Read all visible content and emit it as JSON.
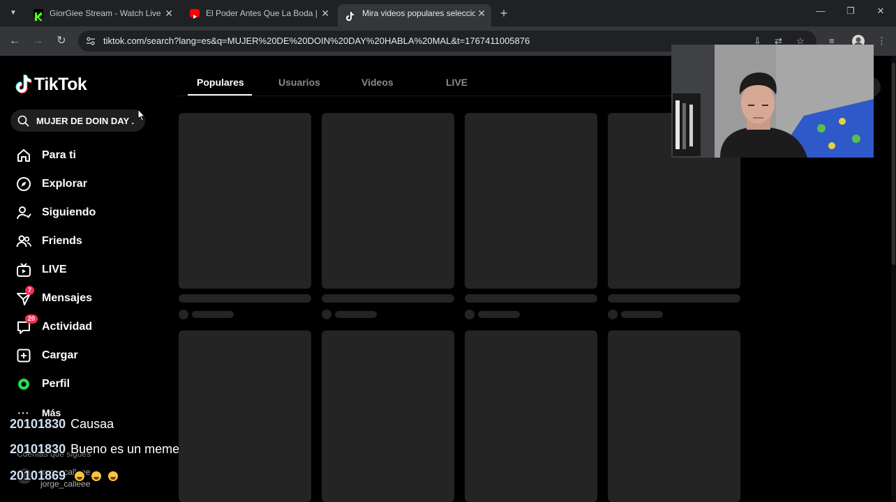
{
  "browser": {
    "tabs": [
      {
        "title": "GiorGiee Stream - Watch Live o",
        "active": false,
        "favicon_color": "#53fc18"
      },
      {
        "title": "El Poder Antes Que La Boda | R",
        "active": false,
        "favicon_color": "#ff0000"
      },
      {
        "title": "Mira videos populares seleccio",
        "active": true,
        "favicon_color": "#ffffff"
      }
    ],
    "new_tab_glyph": "+",
    "close_glyph": "✕",
    "url": "tiktok.com/search?lang=es&q=MUJER%20DE%20DOIN%20DAY%20HABLA%20MAL&t=1767411005876"
  },
  "tiktok": {
    "logo_text": "TikTok",
    "search_value": "MUJER DE DOIN DAY ...",
    "nav": [
      {
        "label": "Para ti",
        "icon": "home-icon"
      },
      {
        "label": "Explorar",
        "icon": "compass-icon"
      },
      {
        "label": "Siguiendo",
        "icon": "following-icon"
      },
      {
        "label": "Friends",
        "icon": "friends-icon"
      },
      {
        "label": "LIVE",
        "icon": "live-tv-icon"
      },
      {
        "label": "Mensajes",
        "icon": "messages-icon",
        "badge": "7"
      },
      {
        "label": "Actividad",
        "icon": "activity-icon",
        "badge": "20"
      },
      {
        "label": "Cargar",
        "icon": "upload-icon"
      },
      {
        "label": "Perfil",
        "icon": "profile-icon"
      },
      {
        "label": "Más",
        "icon": "more-icon"
      }
    ],
    "following_header": "Cuentas que sigues",
    "following_user": "jorge_calleee",
    "search_tabs": [
      "Populares",
      "Usuarios",
      "Videos",
      "LIVE"
    ],
    "active_search_tab": "Populares",
    "accent_color": "#fe2c55"
  },
  "chat": [
    {
      "user": "20101830",
      "message": "Causaa",
      "emoji_count": 0
    },
    {
      "user": "20101830",
      "message": "Bueno es un meme",
      "emoji_count": 0
    },
    {
      "user": "20101869",
      "message": "",
      "emoji_count": 3
    }
  ]
}
